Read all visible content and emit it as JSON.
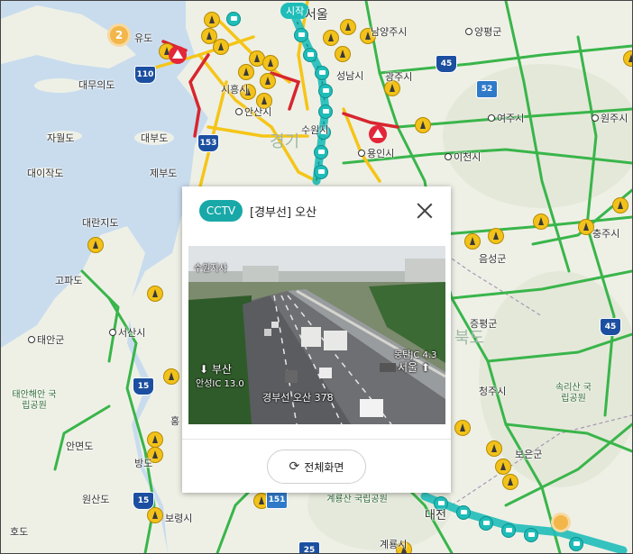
{
  "map": {
    "places": {
      "seoul": "서울",
      "start": "시작",
      "yangpyeong": "양평군",
      "namyangju": "남양주시",
      "seongnam": "성남시",
      "gwangju": "광주시",
      "ansan": "안산시",
      "siheung": "시흥시",
      "suwon": "수원시",
      "yongin": "용인시",
      "icheon": "이천시",
      "yeoju": "여주시",
      "wonju": "원주시",
      "yudo": "유도",
      "daemuuido": "대무의도",
      "jawoldo": "자월도",
      "daebudo": "대부도",
      "daeijakdo": "대이작도",
      "jebudo": "제부도",
      "gyeonggi": "경기",
      "chungju": "충주시",
      "eumseong": "음성군",
      "jeungpyeong": "증평군",
      "cheongju": "청주시",
      "boeun": "보은군",
      "daeranjido": "대란지도",
      "gopado": "고파도",
      "seosan": "서산시",
      "taean": "태안군",
      "taean_park": "태안해안 국립공원",
      "anmyeondo": "안면도",
      "wonsando": "원산도",
      "hodo": "호도",
      "boryeong": "보령시",
      "gyeryongsan_park": "계룡산 국립공원",
      "gyeryong": "계룡시",
      "songnisan_park": "속리산 국립공원",
      "daejeon": "대전",
      "hong": "홍",
      "bang": "방도",
      "chungbuk": "북도"
    },
    "cluster_count": "2",
    "shields": [
      "110",
      "153",
      "45",
      "52",
      "15",
      "15",
      "151",
      "45",
      "25"
    ]
  },
  "popup": {
    "badge": "CCTV",
    "title": "[경부선] 오산",
    "close_label": "",
    "cctv_overlay": {
      "top_left": "수원지사",
      "bottom_left_dir": "부산",
      "bottom_left_sub": "안성IC 13.0",
      "bottom_center": "경부선  오산  378",
      "right_top": "동탄JC 4.3",
      "right_dir": "서울"
    },
    "fullscreen_label": "전체화면"
  },
  "colors": {
    "cctv_badge": "#19a8a8",
    "route_highlight": "#1fbdb9",
    "road_green": "#39b54a",
    "road_yellow": "#f5c518",
    "road_red": "#d7262e"
  }
}
